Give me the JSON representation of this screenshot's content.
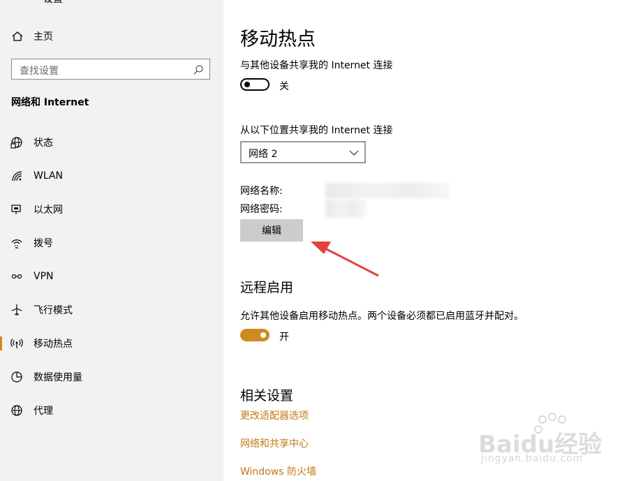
{
  "sidebar": {
    "cut_title": "设置",
    "home_label": "主页",
    "search_placeholder": "查找设置",
    "section_title": "网络和 Internet",
    "items": [
      {
        "label": "状态",
        "icon": "globe-status-icon"
      },
      {
        "label": "WLAN",
        "icon": "wifi-icon"
      },
      {
        "label": "以太网",
        "icon": "ethernet-icon"
      },
      {
        "label": "拨号",
        "icon": "dialup-icon"
      },
      {
        "label": "VPN",
        "icon": "vpn-icon"
      },
      {
        "label": "飞行模式",
        "icon": "airplane-icon"
      },
      {
        "label": "移动热点",
        "icon": "hotspot-icon",
        "active": true
      },
      {
        "label": "数据使用量",
        "icon": "data-usage-icon"
      },
      {
        "label": "代理",
        "icon": "proxy-globe-icon"
      }
    ]
  },
  "main": {
    "title": "移动热点",
    "share_label": "与其他设备共享我的 Internet 连接",
    "share_toggle_state": "关",
    "share_from_label": "从以下位置共享我的 Internet 连接",
    "share_from_value": "网络 2",
    "network_name_label": "网络名称:",
    "network_password_label": "网络密码:",
    "edit_button": "编辑",
    "remote_title": "远程启用",
    "remote_desc": "允许其他设备启用移动热点。两个设备必须都已启用蓝牙并配对。",
    "remote_toggle_state": "开",
    "related_title": "相关设置",
    "related_links": [
      "更改适配器选项",
      "网络和共享中心",
      "Windows 防火墙"
    ]
  },
  "watermark": {
    "brand": "Baidu经验",
    "url": "jingyan.baidu.com"
  },
  "colors": {
    "accent": "#d08a20",
    "link": "#c07a15",
    "sidebar_bg": "#f2f2f2",
    "arrow": "#e8403a"
  }
}
